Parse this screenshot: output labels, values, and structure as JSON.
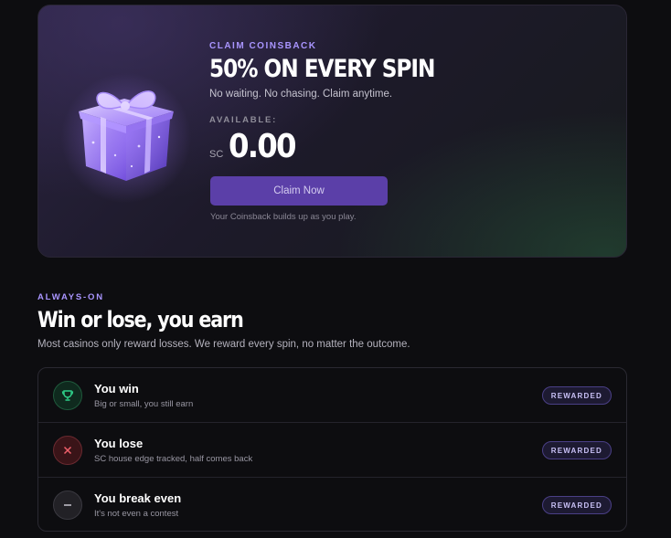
{
  "promo": {
    "eyebrow": "CLAIM COINSBACK",
    "headline": "50% ON EVERY SPIN",
    "subline": "No waiting. No chasing. Claim anytime.",
    "available_label": "AVAILABLE:",
    "currency": "SC",
    "amount": "0.00",
    "claim_button": "Claim Now",
    "hint": "Your Coinsback builds up as you play.",
    "icon": "gift-box-icon"
  },
  "section": {
    "eyebrow": "ALWAYS-ON",
    "title": "Win or lose, you earn",
    "description": "Most casinos only reward losses. We reward every spin, no matter the outcome."
  },
  "outcomes": [
    {
      "icon": "trophy-icon",
      "title": "You win",
      "subtitle": "Big or small, you still earn",
      "badge": "REWARDED",
      "color": "#2fd08a"
    },
    {
      "icon": "close-icon",
      "title": "You lose",
      "subtitle": "SC house edge tracked, half comes back",
      "badge": "REWARDED",
      "color": "#f0606a"
    },
    {
      "icon": "minus-icon",
      "title": "You break even",
      "subtitle": "It's not even a contest",
      "badge": "REWARDED",
      "color": "#c8c6cf"
    }
  ],
  "colors": {
    "accent": "#a995ff",
    "button": "#5b3fa8",
    "background": "#0d0d10"
  }
}
